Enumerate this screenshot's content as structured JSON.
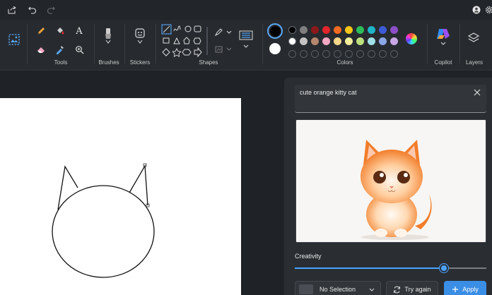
{
  "ribbon": {
    "groups": {
      "tools": "Tools",
      "brushes": "Brushes",
      "stickers": "Stickers",
      "shapes": "Shapes",
      "colors": "Colors",
      "copilot": "Copilot",
      "layers": "Layers"
    },
    "tools_text_glyph": "A",
    "colors": {
      "row1": [
        "#000000",
        "#7f7f7f",
        "#8b1a1a",
        "#e0262b",
        "#f26b22",
        "#f5c518",
        "#2ebd59",
        "#1fb5c9",
        "#3c5bd6",
        "#8d4fc9"
      ],
      "row2": [
        "#ffffff",
        "#c3c3c3",
        "#b5866b",
        "#f2a7c3",
        "#f7d78a",
        "#f3ef9a",
        "#bde07c",
        "#9fe0e8",
        "#8aa6e6",
        "#c9a7e6"
      ],
      "primary": "#000000",
      "secondary": "#ffffff"
    }
  },
  "cocreator": {
    "prompt": "cute orange kitty cat",
    "creativity_label": "Creativity",
    "creativity_value": 0.78,
    "selection_label": "No Selection",
    "try_again_label": "Try again",
    "apply_label": "Apply",
    "accent": "#3a8ee6"
  }
}
